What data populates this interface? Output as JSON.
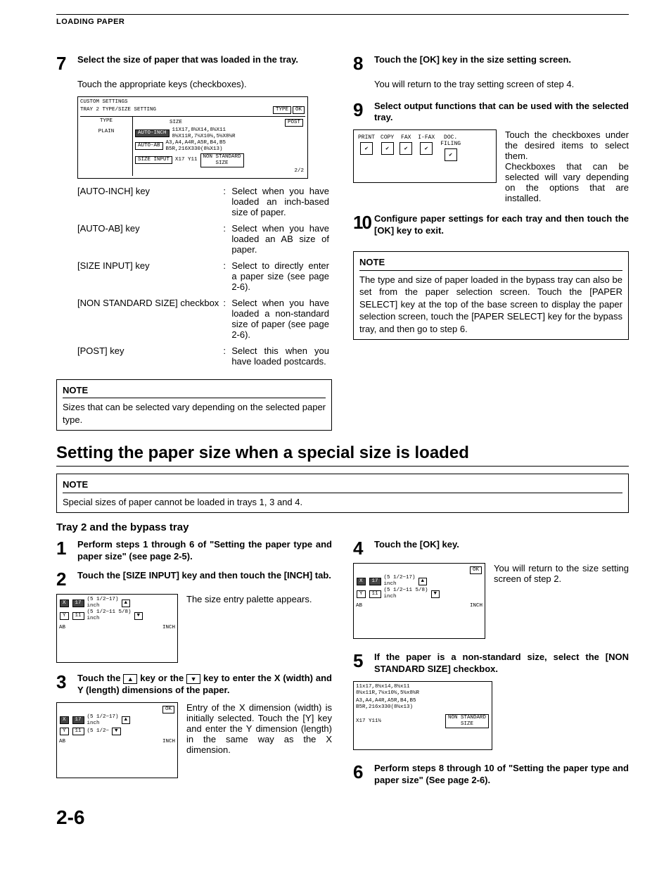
{
  "header": {
    "title": "LOADING PAPER"
  },
  "step7": {
    "num": "7",
    "title": "Select the size of paper that was loaded in the tray.",
    "line1": "Touch the appropriate keys (checkboxes).",
    "panel": {
      "heading": "CUSTOM SETTINGS",
      "sub": "TRAY 2 TYPE/SIZE SETTING",
      "type_btn": "TYPE",
      "ok_btn": "OK",
      "col_type": "TYPE",
      "col_size": "SIZE",
      "post": "POST",
      "plain": "PLAIN",
      "auto_inch": "AUTO-INCH",
      "auto_ab": "AUTO-AB",
      "size_input": "SIZE INPUT",
      "sizes1": "11X17,8½X14,8½X11\n8½X11R,7¼X10½,5½X8½R",
      "sizes2": "A3,A4,A4R,A5R,B4,B5\nB5R,216X330(8½X13)",
      "xy": "X17   Y11",
      "nss": "NON STANDARD\nSIZE",
      "page": "2/2"
    },
    "defs": [
      {
        "key": "[AUTO-INCH] key",
        "sep": ":",
        "val": "Select when you have loaded an inch-based size of paper."
      },
      {
        "key": "[AUTO-AB] key",
        "sep": ":",
        "val": "Select when you have loaded an AB size of paper."
      },
      {
        "key": "[SIZE INPUT] key",
        "sep": ":",
        "val": "Select to directly enter a paper size (see page 2-6)."
      },
      {
        "key": "[NON STANDARD SIZE] checkbox",
        "sep": ":",
        "val": "Select when you have loaded a non-standard size of paper (see page 2-6)."
      },
      {
        "key": "[POST] key",
        "sep": ":",
        "val": "Select this when you have loaded postcards."
      }
    ],
    "note_label": "NOTE",
    "note_text": "Sizes that can be selected vary depending on the selected paper type."
  },
  "step8": {
    "num": "8",
    "title": "Touch the [OK] key in the size setting screen.",
    "body": "You will return to the tray setting screen of step 4."
  },
  "step9": {
    "num": "9",
    "title": "Select output functions that can be used with the selected tray.",
    "checkboxes": [
      "PRINT",
      "COPY",
      "FAX",
      "I-FAX",
      "DOC.\nFILING"
    ],
    "body": "Touch the checkboxes under the desired items to select them.\nCheckboxes that can be selected will vary depending on the options that are installed."
  },
  "step10": {
    "num": "10",
    "title": "Configure paper settings for each tray and then touch the [OK] key to exit."
  },
  "right_note": {
    "label": "NOTE",
    "text": "The type and size of paper loaded in the bypass tray can also be set from the paper selection screen. Touch the [PAPER SELECT] key at the top of the base screen to display the paper selection screen, touch the [PAPER SELECT] key for the bypass tray, and then go to step 6."
  },
  "section2": {
    "heading": "Setting the paper size when a special size is loaded",
    "note_label": "NOTE",
    "note_text": "Special sizes of paper cannot be loaded in trays 1, 3 and 4.",
    "sub": "Tray 2 and the bypass tray"
  },
  "s2step1": {
    "num": "1",
    "title": "Perform steps 1 through 6 of \"Setting the paper type and paper size\" (see page 2-5)."
  },
  "s2step2": {
    "num": "2",
    "title": "Touch the [SIZE INPUT] key and then touch the [INCH] tab.",
    "side": "The size entry palette appears.",
    "panel": {
      "x": "X",
      "xv": "17",
      "xr": "(5 1/2~17)\ninch",
      "y": "Y",
      "yv": "11",
      "yr": "(5 1/2~11 5/8)\ninch",
      "ab": "AB",
      "inch": "INCH"
    }
  },
  "s2step3": {
    "num": "3",
    "title_pre": "Touch the ",
    "title_mid": " key or the ",
    "title_post": " key to enter the X (width) and Y (length) dimensions of the paper.",
    "side": "Entry of the X dimension (width) is initially selected. Touch the [Y] key and enter the Y dimension (length) in the same way as the X dimension.",
    "panel": {
      "ok": "OK",
      "x": "X",
      "xv": "17",
      "xr": "(5 1/2~17)\ninch",
      "y": "Y",
      "yv": "11",
      "yr": "(5 1/2~\n",
      "ab": "AB",
      "inch": "INCH"
    }
  },
  "s2step4": {
    "num": "4",
    "title": "Touch the [OK] key.",
    "side": "You will return to the size setting screen of step 2.",
    "panel": {
      "ok": "OK",
      "x": "X",
      "xv": "17",
      "xr": "(5 1/2~17)\ninch",
      "y": "Y",
      "yv": "11",
      "yr": "(5 1/2~11 5/8)\ninch",
      "ab": "AB",
      "inch": "INCH"
    }
  },
  "s2step5": {
    "num": "5",
    "title": "If the paper is a non-standard size, select the [NON STANDARD SIZE] checkbox.",
    "panel": {
      "l1": "11x17,8½x14,8½x11\n8½x11R,7¼x10½,5½x8½R",
      "l2": "A3,A4,A4R,A5R,B4,B5\nB5R,216x330(8½x13)",
      "xy": "X17  Y11½",
      "nss": "NON STANDARD\nSIZE"
    }
  },
  "s2step6": {
    "num": "6",
    "title": "Perform steps 8 through 10 of \"Setting the paper type and paper size\" (See page 2-6)."
  },
  "page_number": "2-6"
}
